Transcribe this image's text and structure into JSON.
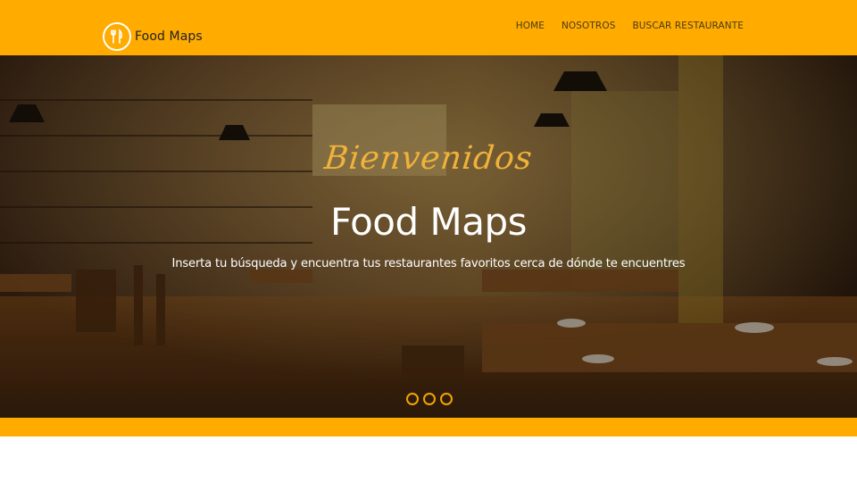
{
  "brand": {
    "name": "Food Maps",
    "logo_icon": "fork-knife-icon"
  },
  "nav": {
    "items": [
      {
        "label": "HOME"
      },
      {
        "label": "NOSOTROS"
      },
      {
        "label": "BUSCAR RESTAURANTE"
      }
    ]
  },
  "hero": {
    "welcome": "Bienvenidos",
    "title": "Food Maps",
    "subtitle": "Inserta tu búsqueda y encuentra tus restaurantes favoritos cerca de dónde te encuentres",
    "slide_count": 3
  },
  "colors": {
    "accent": "#ffab00",
    "welcome_text": "#f0b23a",
    "dot_border": "#f0a500"
  }
}
